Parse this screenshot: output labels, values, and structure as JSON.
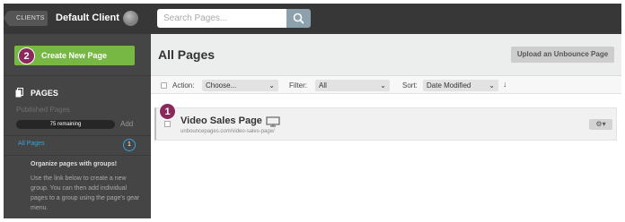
{
  "topbar": {
    "clients_label": "CLIENTS",
    "client_name": "Default Client",
    "search_placeholder": "Search Pages..."
  },
  "sidebar": {
    "create_step": "2",
    "create_label": "Create New Page",
    "pages_heading": "PAGES",
    "published_label": "Published Pages",
    "remaining": "75 remaining",
    "add_label": "Add",
    "all_pages_label": "All Pages",
    "all_pages_count": "1",
    "groups_title": "Organize pages with groups!",
    "groups_desc": "Use the link below to create a new group. You can then add individual pages to a group using the page's gear menu."
  },
  "main": {
    "title": "All Pages",
    "upload_label": "Upload an Unbounce Page",
    "filters": {
      "action_label": "Action:",
      "action_value": "Choose...",
      "filter_label": "Filter:",
      "filter_value": "All",
      "sort_label": "Sort:",
      "sort_value": "Date Modified"
    },
    "pages": [
      {
        "step": "1",
        "title": "Video Sales Page",
        "url": "unbouncepages.com/video-sales-page/"
      }
    ]
  },
  "colors": {
    "topbar_bg": "#373737",
    "sidebar_bg": "#454545",
    "create_button": "#77b844",
    "step_badge": "#8a2a5c",
    "link_blue": "#36a3d9"
  },
  "icons": [
    "search-icon",
    "pages-icon",
    "monitor-icon",
    "gear-icon",
    "chevron-down-icon",
    "sort-arrow-icon"
  ]
}
